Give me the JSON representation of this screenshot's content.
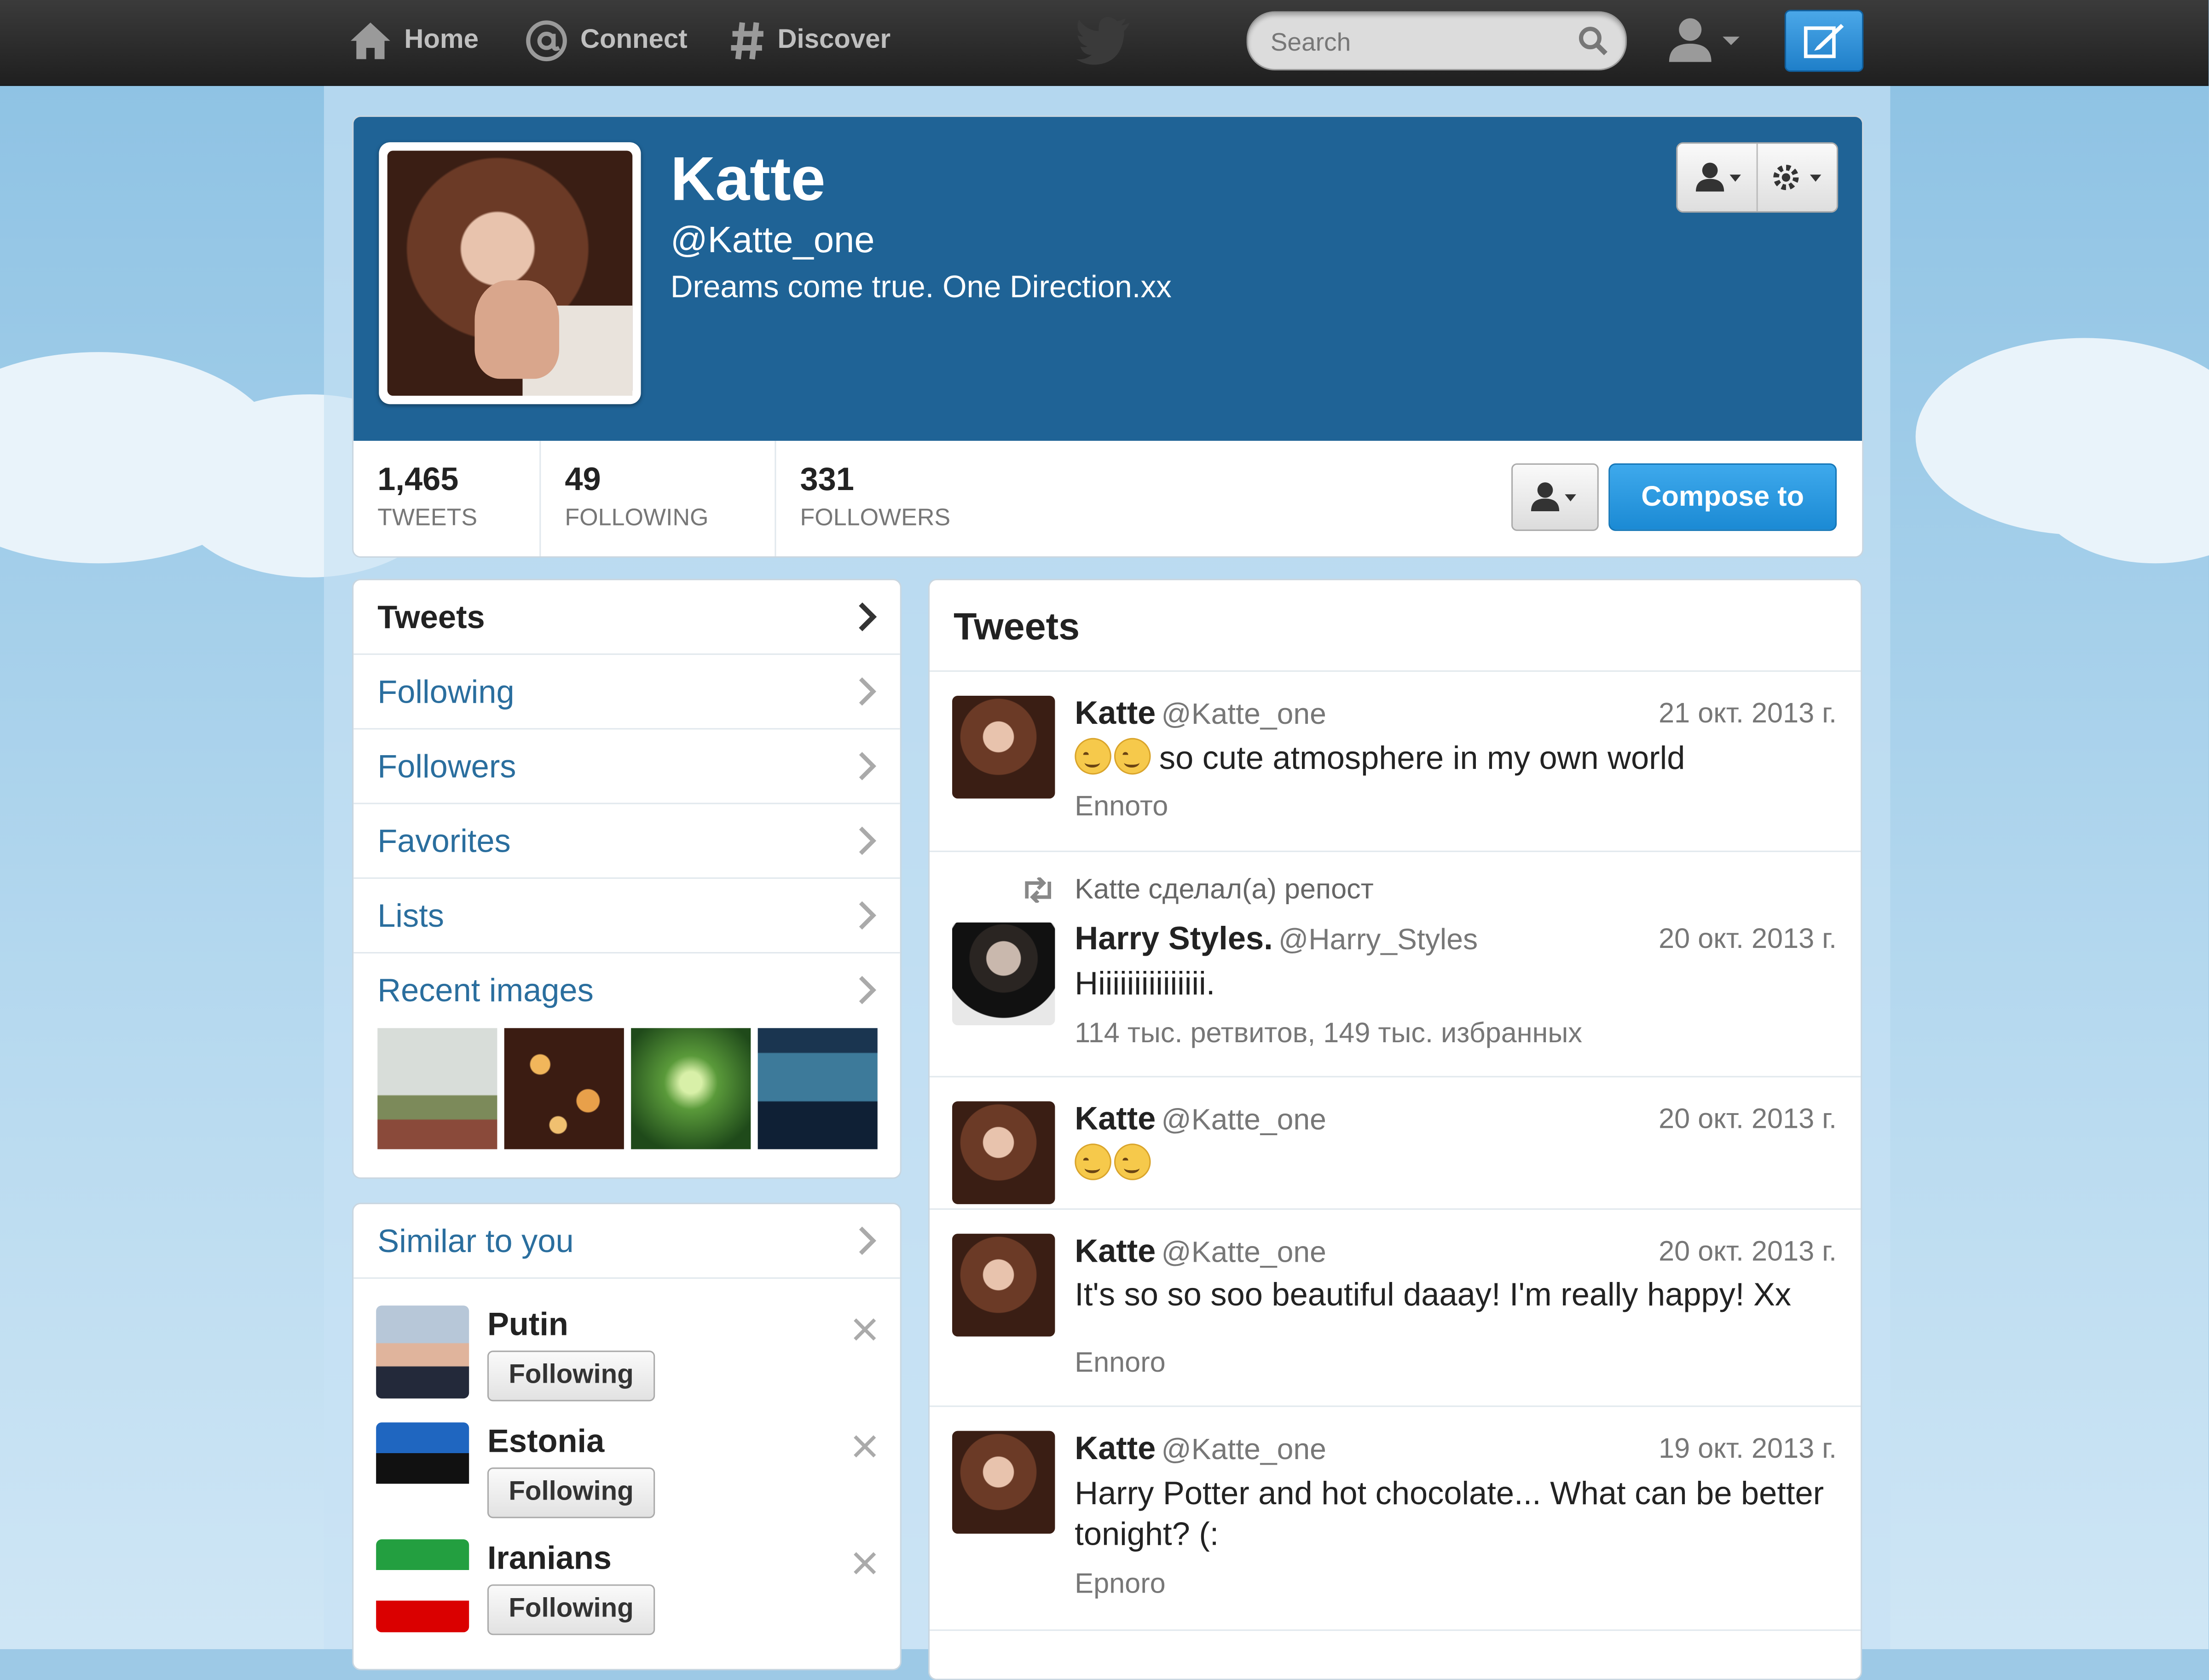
{
  "topbar": {
    "nav": [
      {
        "label": "Home",
        "icon": "home-icon"
      },
      {
        "label": "Connect",
        "icon": "at-icon"
      },
      {
        "label": "Discover",
        "icon": "hash-icon"
      }
    ],
    "search_placeholder": "Search"
  },
  "profile": {
    "name": "Katte",
    "handle": "@Katte_one",
    "bio": "Dreams come true. One Direction.xx",
    "stats": [
      {
        "num": "1,465",
        "label": "TWEETS"
      },
      {
        "num": "49",
        "label": "FOLLOWING"
      },
      {
        "num": "331",
        "label": "FOLLOWERS"
      }
    ],
    "compose_label": "Compose to"
  },
  "sidebar": {
    "items": [
      {
        "label": "Tweets"
      },
      {
        "label": "Following"
      },
      {
        "label": "Followers"
      },
      {
        "label": "Favorites"
      },
      {
        "label": "Lists"
      },
      {
        "label": "Recent images"
      }
    ]
  },
  "similar": {
    "title": "Similar to you",
    "users": [
      {
        "name": "Putin",
        "button": "Following"
      },
      {
        "name": "Estonia",
        "button": "Following"
      },
      {
        "name": "Iranians",
        "button": "Following"
      }
    ]
  },
  "timeline": {
    "title": "Tweets",
    "tweets": [
      {
        "name": "Katte",
        "handle": "@Katte_one",
        "date": "21 окт. 2013 г.",
        "text": "so cute atmosphere in my own world",
        "meta": "Еnnото"
      },
      {
        "retweet_note": "Katte сделал(а) репост",
        "name": "Harry Styles.",
        "handle": "@Harry_Styles",
        "date": "20 окт. 2013 г.",
        "text": "Hiiiiiiiiiiiiiii.",
        "meta": "114 тыс. ретвитов, 149 тыс. избранных"
      },
      {
        "name": "Katte",
        "handle": "@Katte_one",
        "date": "20 окт. 2013 г.",
        "text": ""
      },
      {
        "name": "Katte",
        "handle": "@Katte_one",
        "date": "20 окт. 2013 г.",
        "text": "It's so so soo beautiful daaay! I'm really happy! Xx",
        "meta": "Еnnoro"
      },
      {
        "name": "Katte",
        "handle": "@Katte_one",
        "date": "19 окт. 2013 г.",
        "text": "Harry Potter and hot chocolate... What can be better tonight? (:",
        "meta": "Еpnoro"
      }
    ]
  },
  "colors": {
    "banner": "#1f6396",
    "link": "#2a6e9e",
    "accent": "#1b8ad4"
  }
}
